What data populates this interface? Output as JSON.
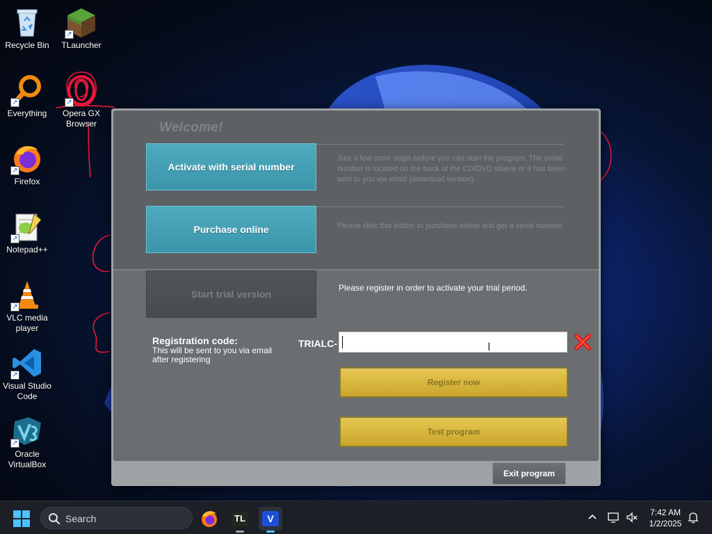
{
  "desktop": {
    "icons": [
      {
        "label": "Recycle Bin"
      },
      {
        "label": "TLauncher"
      },
      {
        "label": "Everything"
      },
      {
        "label": "Opera GX Browser"
      },
      {
        "label": "Firefox"
      },
      {
        "label": "Notepad++"
      },
      {
        "label": "VLC media player"
      },
      {
        "label": "Visual Studio Code"
      },
      {
        "label": "Oracle VirtualBox"
      }
    ]
  },
  "dialog": {
    "welcome": "Welcome!",
    "activate_label": "Activate with serial number",
    "activate_desc": "Just a few more steps before you can start the program. The serial number is located on the back of the CD/DVD sleeve or it has been sent to you via email (download version).",
    "purchase_label": "Purchase online",
    "purchase_desc": "Please click this button to purchase online and get a serial number.",
    "trial_label": "Start trial version",
    "trial_msg": "Please register in order to activate your trial period.",
    "reg_title": "Registration code:",
    "reg_sub": "This will be sent to you via email after registering",
    "reg_prefix": "TRIALC-",
    "reg_value": "",
    "register_label": "Register now",
    "test_label": "Test program",
    "exit_label": "Exit program"
  },
  "taskbar": {
    "search_label": "Search",
    "apps": [
      {
        "name": "Firefox",
        "text": ""
      },
      {
        "name": "TLauncher",
        "text": "TL"
      },
      {
        "name": "App V",
        "text": "V"
      }
    ],
    "time": "7:42 AM",
    "date": "1/2/2025"
  },
  "colors": {
    "accent_teal": "#4eaabf",
    "gold": "#d8b83d",
    "dialog_bg": "#6a6e71"
  }
}
